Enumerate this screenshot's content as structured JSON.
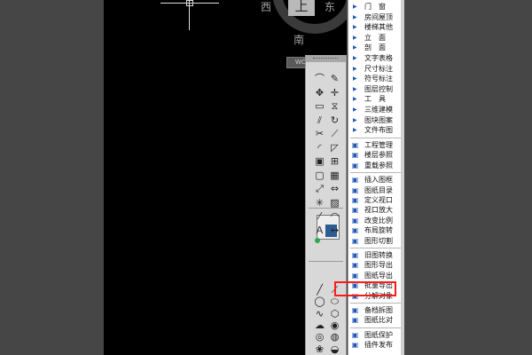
{
  "viewcube": {
    "top_label": "上",
    "west": "西",
    "east": "东",
    "south": "南",
    "wcs_label": "WCS"
  },
  "menu": {
    "submenu_items": [
      {
        "label": "门　窗"
      },
      {
        "label": "房间屋顶"
      },
      {
        "label": "楼梯其他"
      },
      {
        "label": "立　面"
      },
      {
        "label": "剖　面"
      },
      {
        "label": "文字表格"
      },
      {
        "label": "尺寸标注"
      },
      {
        "label": "符号标注"
      },
      {
        "label": "图层控制"
      },
      {
        "label": "工　具"
      },
      {
        "label": "三维建模"
      },
      {
        "label": "图块图案"
      },
      {
        "label": "文件布图"
      }
    ],
    "command_items": [
      {
        "label": "工程管理",
        "icon": "project-icon"
      },
      {
        "label": "楼层参照",
        "icon": "floor-ref-icon"
      },
      {
        "label": "重载参照",
        "icon": "reload-ref-icon"
      },
      {
        "label": "插入图框",
        "icon": "insert-frame-icon"
      },
      {
        "label": "图纸目录",
        "icon": "catalog-icon"
      },
      {
        "label": "定义视口",
        "icon": "viewport-icon"
      },
      {
        "label": "视口放大",
        "icon": "viewport-zoom-icon"
      },
      {
        "label": "改变比例",
        "icon": "scale-icon"
      },
      {
        "label": "布局旋转",
        "icon": "layout-rotate-icon"
      },
      {
        "label": "图形切割",
        "icon": "cut-icon"
      },
      {
        "label": "旧图转换",
        "icon": "convert-icon"
      },
      {
        "label": "图形导出",
        "icon": "export-icon"
      },
      {
        "label": "图纸导出",
        "icon": "sheet-export-icon"
      },
      {
        "label": "批量导出",
        "icon": "batch-export-icon",
        "highlighted": true
      },
      {
        "label": "分解对象",
        "icon": "explode-icon"
      },
      {
        "label": "备档拆图",
        "icon": "archive-split-icon"
      },
      {
        "label": "图纸比对",
        "icon": "compare-icon"
      },
      {
        "label": "图纸保护",
        "icon": "protect-icon"
      },
      {
        "label": "插件发布",
        "icon": "plugin-icon"
      }
    ]
  },
  "palette": {
    "tools": [
      {
        "name": "polyline-tool-icon",
        "glyph": "⌒"
      },
      {
        "name": "pencil-tool-icon",
        "glyph": "✎"
      },
      {
        "name": "pan-tool-icon",
        "glyph": "✥"
      },
      {
        "name": "move-tool-icon",
        "glyph": "✛"
      },
      {
        "name": "rectangle-tool-icon",
        "glyph": "▭"
      },
      {
        "name": "mirror-tool-icon",
        "glyph": "⧖"
      },
      {
        "name": "offset-tool-icon",
        "glyph": "⫽"
      },
      {
        "name": "rotate-tool-icon",
        "glyph": "↻"
      },
      {
        "name": "trim-tool-icon",
        "glyph": "✂"
      },
      {
        "name": "extend-tool-icon",
        "glyph": "⟋"
      },
      {
        "name": "fillet-tool-icon",
        "glyph": "◜"
      },
      {
        "name": "chamfer-tool-icon",
        "glyph": "◸"
      },
      {
        "name": "block-tool-icon",
        "glyph": "▣"
      },
      {
        "name": "insert-tool-icon",
        "glyph": "⊞"
      },
      {
        "name": "region-tool-icon",
        "glyph": "▢"
      },
      {
        "name": "array-tool-icon",
        "glyph": "▦"
      },
      {
        "name": "scale-tool-icon",
        "glyph": "⤢"
      },
      {
        "name": "stretch-tool-icon",
        "glyph": "⇔"
      },
      {
        "name": "explode-tool-icon",
        "glyph": "✳"
      },
      {
        "name": "hatch-tool-icon",
        "glyph": "▨"
      },
      {
        "name": "line-tool-icon",
        "glyph": "⁄"
      },
      {
        "name": "arc-tool-icon",
        "glyph": "◠"
      },
      {
        "name": "text-tool-icon",
        "glyph": "Ａ"
      },
      {
        "name": "dimension-tool-icon",
        "glyph": "↔"
      }
    ],
    "lower_tools": [
      {
        "name": "draw-line-icon",
        "glyph": "╱"
      },
      {
        "name": "construction-line-icon",
        "glyph": "⟋"
      },
      {
        "name": "circle-tool-icon",
        "glyph": "◯"
      },
      {
        "name": "ellipse-tool-icon",
        "glyph": "⬭"
      },
      {
        "name": "spline-tool-icon",
        "glyph": "∿"
      },
      {
        "name": "polygon-tool-icon",
        "glyph": "⬡"
      },
      {
        "name": "cloud-tool-icon",
        "glyph": "☁"
      },
      {
        "name": "point-tool-icon",
        "glyph": "◉"
      },
      {
        "name": "donut-tool-icon",
        "glyph": "◎"
      },
      {
        "name": "wipeout-tool-icon",
        "glyph": "◍"
      },
      {
        "name": "revcloud-tool-icon",
        "glyph": "❀"
      },
      {
        "name": "gradient-tool-icon",
        "glyph": "◒"
      }
    ]
  }
}
